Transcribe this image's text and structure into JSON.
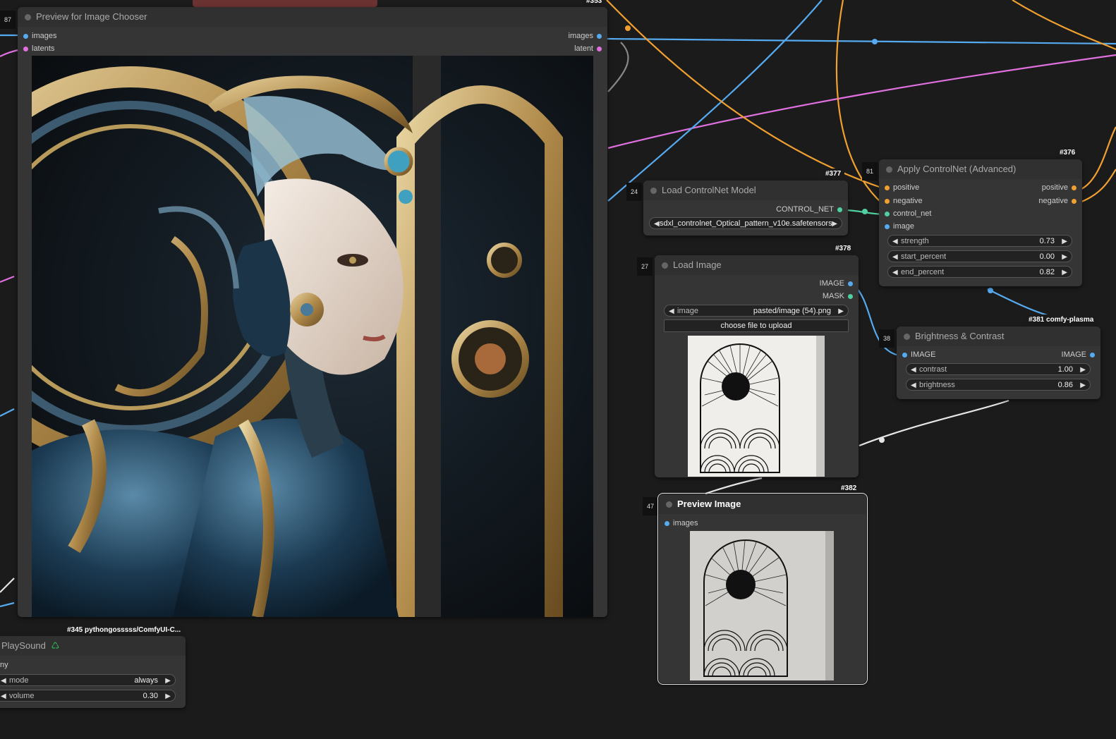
{
  "colors": {
    "blue": "#55aaf0",
    "pink": "#e070e0",
    "orange": "#f0a030",
    "green": "#50d0a0",
    "white": "#e6e6e6"
  },
  "chooser": {
    "id": "87",
    "badge": "#353",
    "title": "Preview for Image Chooser",
    "in_images": "images",
    "in_latents": "latents",
    "out_images": "images",
    "out_latent": "latent",
    "image_desc": "ornate biomechanical woman portrait with gold gears and blue armor"
  },
  "controlnet_model": {
    "id": "24",
    "badge": "#377",
    "title": "Load ControlNet Model",
    "output": "CONTROL_NET",
    "widget_value": "sdxl_controlnet_Optical_pattern_v10e.safetensors"
  },
  "apply_controlnet": {
    "id": "81",
    "badge": "#376",
    "title": "Apply ControlNet (Advanced)",
    "inputs": [
      "positive",
      "negative",
      "control_net",
      "image"
    ],
    "outputs": [
      "positive",
      "negative"
    ],
    "widgets": [
      {
        "label": "strength",
        "value": "0.73"
      },
      {
        "label": "start_percent",
        "value": "0.00"
      },
      {
        "label": "end_percent",
        "value": "0.82"
      }
    ]
  },
  "load_image": {
    "id": "27",
    "badge": "#378",
    "title": "Load Image",
    "outputs": [
      "IMAGE",
      "MASK"
    ],
    "widget_label": "image",
    "widget_value": "pasted/image (54).png",
    "upload_label": "choose file to upload"
  },
  "brightness": {
    "id": "38",
    "badge": "#381 comfy-plasma",
    "title": "Brightness & Contrast",
    "input": "IMAGE",
    "output": "IMAGE",
    "widgets": [
      {
        "label": "contrast",
        "value": "1.00"
      },
      {
        "label": "brightness",
        "value": "0.86"
      }
    ]
  },
  "preview_image": {
    "id": "47",
    "badge": "#382",
    "title": "Preview Image",
    "input": "images"
  },
  "playsound": {
    "badge": "#345 pythongosssss/ComfyUI-C...",
    "title": "PlaySound",
    "input": "ny",
    "widgets": [
      {
        "label": "mode",
        "value": "always"
      },
      {
        "label": "volume",
        "value": "0.30"
      }
    ]
  }
}
